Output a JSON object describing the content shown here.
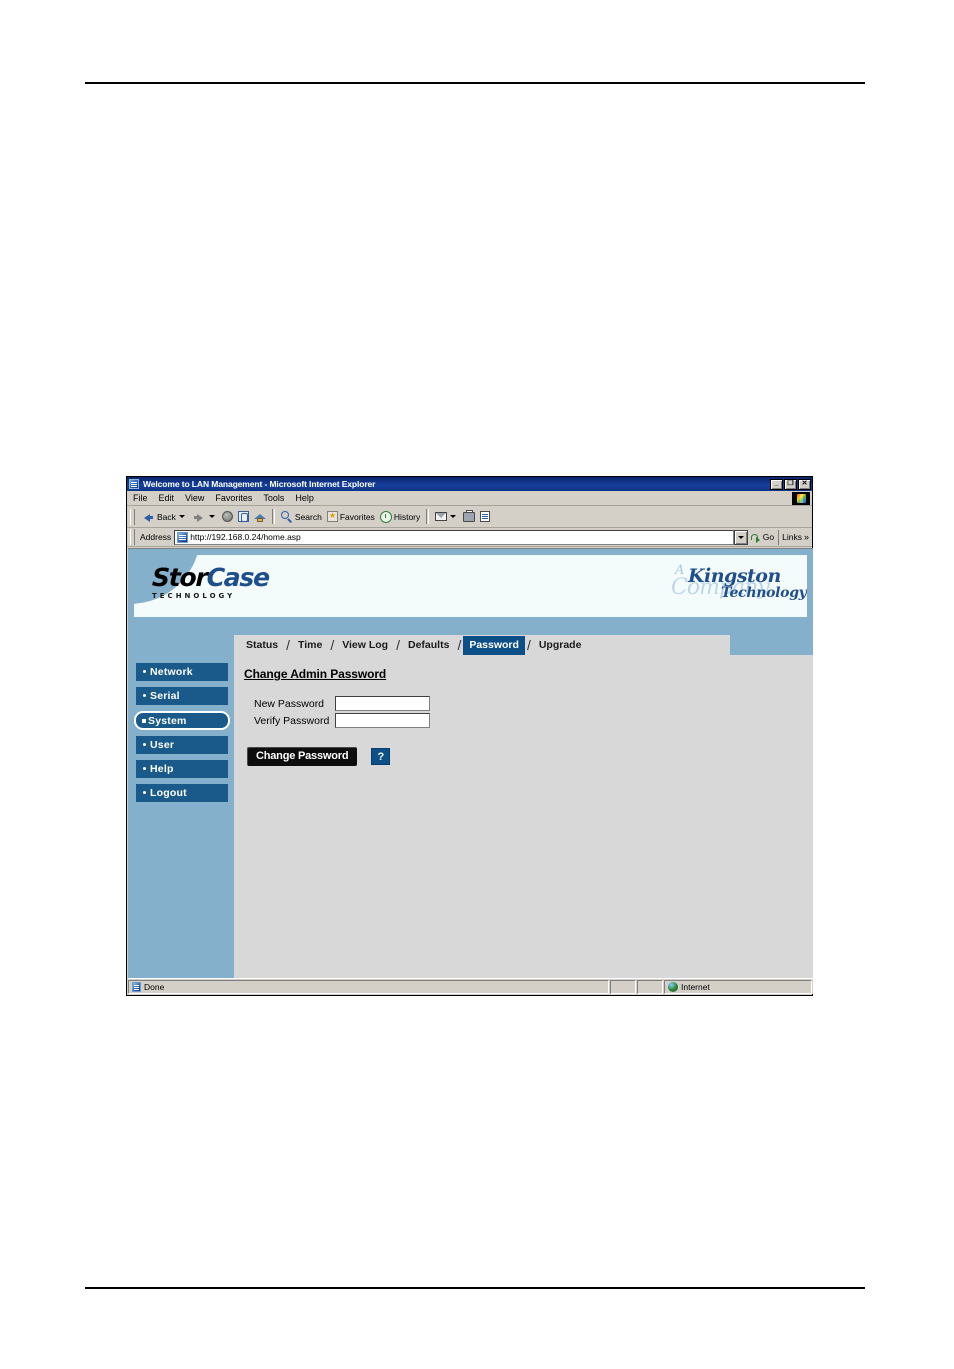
{
  "window": {
    "title": "Welcome to LAN Management - Microsoft Internet Explorer",
    "minimize_label": "_",
    "restore_label": "❐",
    "close_label": "✕"
  },
  "menu": {
    "items": [
      {
        "label": "File"
      },
      {
        "label": "Edit"
      },
      {
        "label": "View"
      },
      {
        "label": "Favorites"
      },
      {
        "label": "Tools"
      },
      {
        "label": "Help"
      }
    ]
  },
  "toolbar": {
    "back_label": "Back",
    "forward_label": "",
    "stop_label": "",
    "refresh_label": "",
    "home_label": "",
    "search_label": "Search",
    "favorites_label": "Favorites",
    "history_label": "History",
    "mail_label": "",
    "print_label": "",
    "edit_label": ""
  },
  "address": {
    "label": "Address",
    "url": "http://192.168.0.24/home.asp",
    "go_label": "Go",
    "links_label": "Links",
    "links_chevron": "»"
  },
  "site": {
    "brand": {
      "word_first": "Stor",
      "word_second": "Case",
      "tagline": "TECHNOLOGY"
    },
    "partner_logo": {
      "a": "A",
      "kingston": "Kingston",
      "technology": "Technology",
      "company": "Company"
    },
    "tabs": [
      {
        "label": "Status",
        "active": false
      },
      {
        "label": "Time",
        "active": false
      },
      {
        "label": "View Log",
        "active": false
      },
      {
        "label": "Defaults",
        "active": false
      },
      {
        "label": "Password",
        "active": true
      },
      {
        "label": "Upgrade",
        "active": false
      }
    ],
    "tab_separator": "/",
    "sidebar": [
      {
        "label": "Network",
        "selected": false
      },
      {
        "label": "Serial",
        "selected": false
      },
      {
        "label": "System",
        "selected": true
      },
      {
        "label": "User",
        "selected": false
      },
      {
        "label": "Help",
        "selected": false
      },
      {
        "label": "Logout",
        "selected": false
      }
    ],
    "content": {
      "heading": "Change Admin Password",
      "fields": [
        {
          "label": "New Password",
          "value": ""
        },
        {
          "label": "Verify Password",
          "value": ""
        }
      ],
      "submit_label": "Change Password",
      "help_label": "?"
    }
  },
  "status_bar": {
    "message": "Done",
    "zone": "Internet"
  },
  "colors": {
    "title_bar": "#0a246a",
    "site_blue": "#84b0cb",
    "nav_blue": "#1a5a8a",
    "tab_active": "#0d4f87",
    "content_gray": "#d8d8d8",
    "chrome_gray": "#d4d0c8",
    "brand_blue": "#1f4e8c"
  }
}
